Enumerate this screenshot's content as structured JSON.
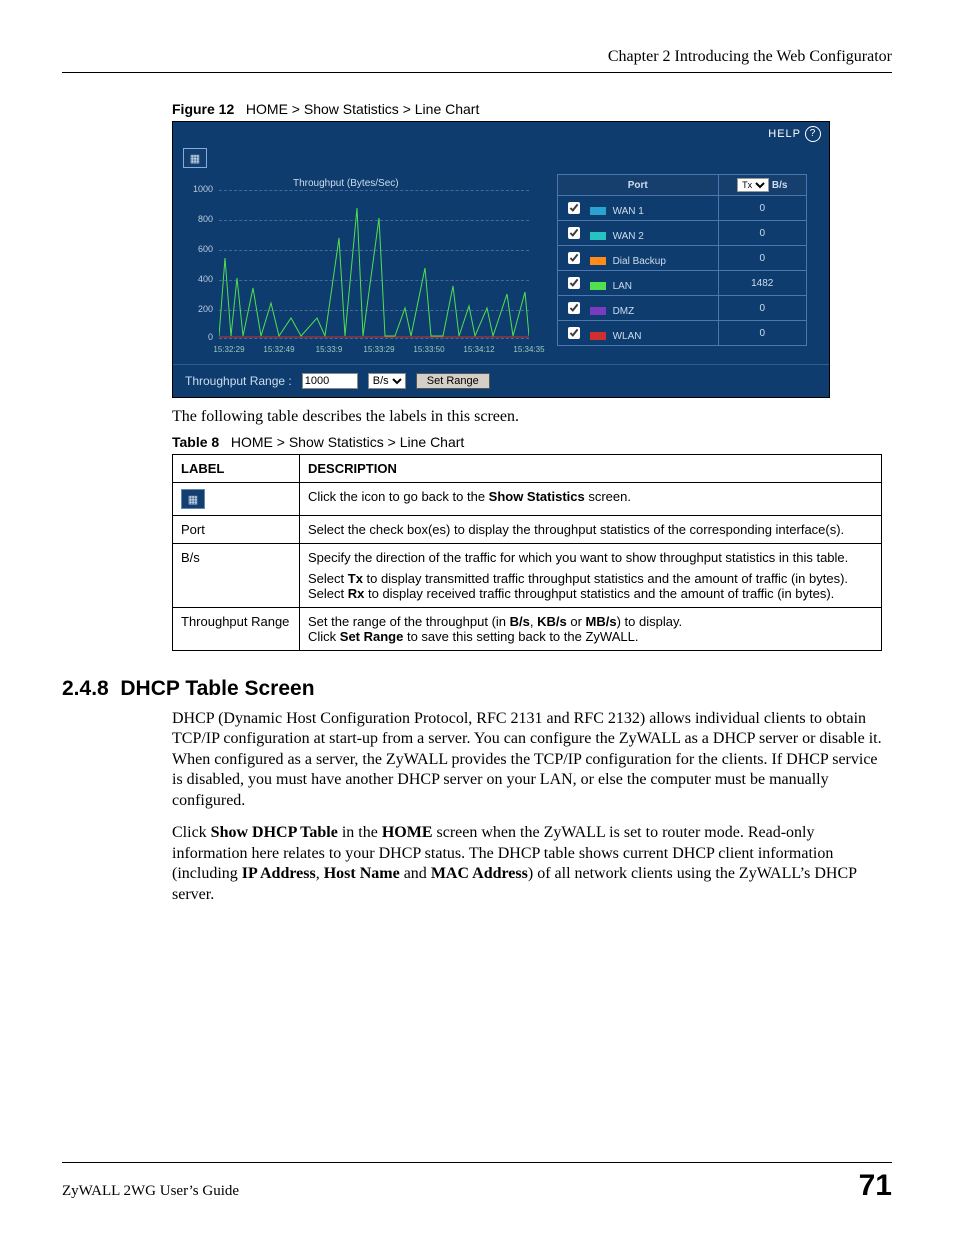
{
  "chapter_header": "Chapter 2 Introducing the Web Configurator",
  "figure": {
    "number": "Figure 12",
    "caption": "HOME > Show Statistics > Line Chart"
  },
  "help_label": "HELP",
  "chart_data": {
    "type": "line",
    "title": "Throughput (Bytes/Sec)",
    "ylabel": "",
    "xlabel": "",
    "ylim": [
      0,
      1000
    ],
    "y_ticks": [
      0,
      200,
      400,
      600,
      800,
      1000
    ],
    "x_ticks": [
      "15:32:29",
      "15:32:49",
      "15:33:9",
      "15:33:29",
      "15:33:50",
      "15:34:12",
      "15:34:35"
    ],
    "series": [
      {
        "name": "WAN 1",
        "color": "#2aa3d1",
        "value_display": "0"
      },
      {
        "name": "WAN 2",
        "color": "#27c2c2",
        "value_display": "0"
      },
      {
        "name": "Dial Backup",
        "color": "#ff8c1a",
        "value_display": "0"
      },
      {
        "name": "LAN",
        "color": "#50e050",
        "value_display": "1482"
      },
      {
        "name": "DMZ",
        "color": "#7a3cbf",
        "value_display": "0"
      },
      {
        "name": "WLAN",
        "color": "#d02f2f",
        "value_display": "0"
      }
    ]
  },
  "legend_headers": {
    "port": "Port",
    "tx_sel": "Tx",
    "bs": "B/s"
  },
  "range_bar": {
    "label": "Throughput Range :",
    "value": "1000",
    "unit": "B/s",
    "button": "Set Range"
  },
  "table_intro": "The following table describes the labels in this screen.",
  "table_caption": {
    "number": "Table 8",
    "caption": "HOME > Show Statistics > Line Chart"
  },
  "table_headers": {
    "label": "LABEL",
    "desc": "DESCRIPTION"
  },
  "table_rows": {
    "r0": {
      "label_icon": true,
      "desc_pre": "Click the icon to go back to the ",
      "desc_bold": "Show Statistics",
      "desc_post": " screen."
    },
    "r1": {
      "label": "Port",
      "desc": "Select the check box(es) to display the throughput statistics of the corresponding interface(s)."
    },
    "r2": {
      "label": "B/s",
      "p1": "Specify the direction of the traffic for which you want to show throughput statistics in this table.",
      "p2_pre": "Select ",
      "p2_b1": "Tx",
      "p2_mid": " to display transmitted traffic throughput statistics and the amount of traffic (in bytes). Select ",
      "p2_b2": "Rx",
      "p2_post": " to display received traffic throughput statistics and the amount of traffic (in bytes)."
    },
    "r3": {
      "label": "Throughput Range",
      "l1_pre": "Set the range of the throughput (in ",
      "l1_b1": "B/s",
      "l1_c1": ", ",
      "l1_b2": "KB/s",
      "l1_c2": " or ",
      "l1_b3": "MB/s",
      "l1_post": ") to display.",
      "l2_pre": "Click ",
      "l2_b1": "Set Range",
      "l2_post": " to save this setting back to the ZyWALL."
    }
  },
  "section": {
    "number": "2.4.8",
    "title": "DHCP Table Screen"
  },
  "para1": "DHCP (Dynamic Host Configuration Protocol, RFC 2131 and RFC 2132) allows individual clients to obtain TCP/IP configuration at start-up from a server. You can configure the ZyWALL as a DHCP server or disable it. When configured as a server, the ZyWALL provides the TCP/IP configuration for the clients. If DHCP service is disabled, you must have another DHCP server on your LAN, or else the computer must be manually configured.",
  "para2": {
    "t0": "Click ",
    "b1": "Show DHCP Table",
    "t1": " in the ",
    "b2": "HOME",
    "t2": " screen when the ZyWALL is set to router mode. Read-only information here relates to your DHCP status. The DHCP table shows current DHCP client information (including ",
    "b3": "IP Address",
    "t3": ", ",
    "b4": "Host Name",
    "t4": " and ",
    "b5": "MAC Address",
    "t5": ") of all network clients using the ZyWALL’s DHCP server."
  },
  "footer": {
    "guide": "ZyWALL 2WG User’s Guide",
    "page": "71"
  }
}
